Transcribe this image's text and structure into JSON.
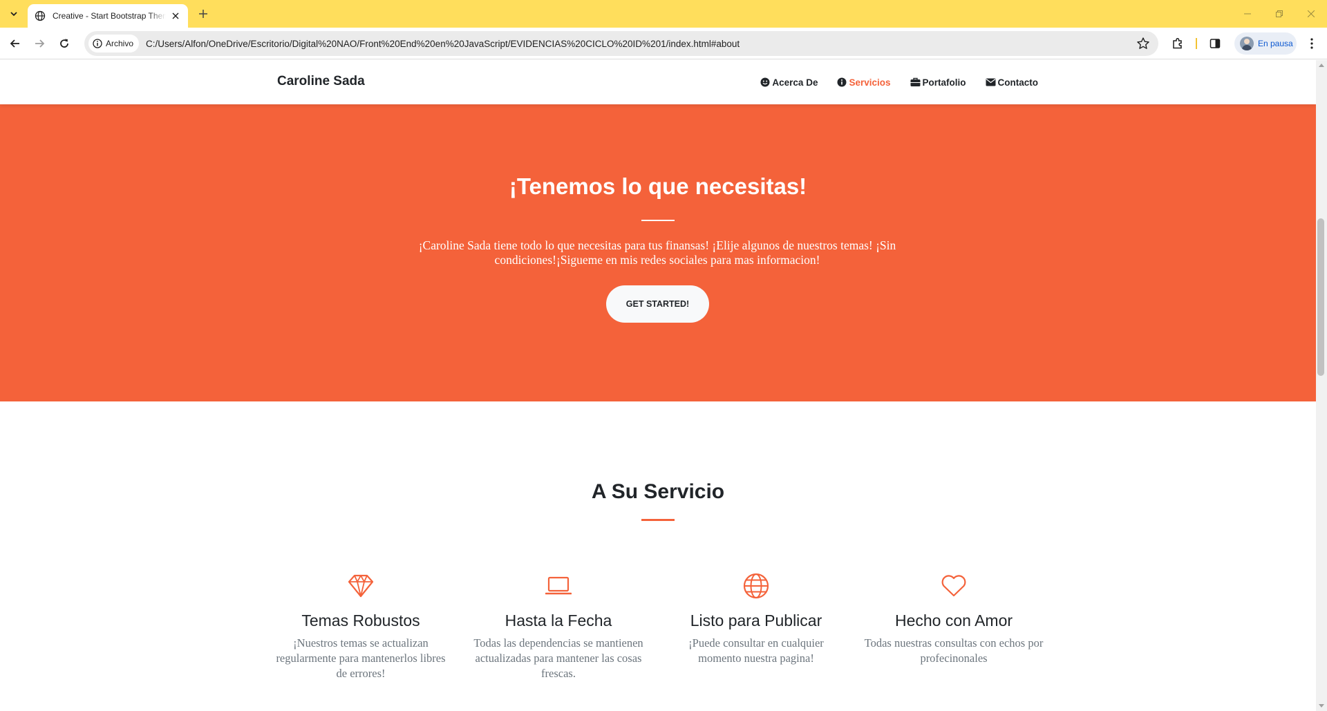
{
  "browser": {
    "tab_title": "Creative - Start Bootstrap Theme",
    "site_chip": "Archivo",
    "url": "C:/Users/Alfon/OneDrive/Escritorio/Digital%20NAO/Front%20End%20en%20JavaScript/EVIDENCIAS%20CICLO%20ID%201/index.html#about",
    "profile_label": "En pausa",
    "colors": {
      "tabbar": "#ffde5c"
    }
  },
  "navbar": {
    "brand": "Caroline Sada",
    "links": [
      {
        "label": "Acerca De",
        "icon": "smile-icon",
        "active": false
      },
      {
        "label": "Servicios",
        "icon": "info-circle-icon",
        "active": true
      },
      {
        "label": "Portafolio",
        "icon": "briefcase-icon",
        "active": false
      },
      {
        "label": "Contacto",
        "icon": "envelope-icon",
        "active": false
      }
    ]
  },
  "hero": {
    "title": "¡Tenemos lo que necesitas!",
    "text": "¡Caroline Sada tiene todo lo que necesitas para tus finansas! ¡Elije algunos de nuestros temas! ¡Sin condiciones!¡Sigueme en mis redes sociales para mas informacion!",
    "button": "GET STARTED!"
  },
  "services": {
    "title": "A Su Servicio",
    "items": [
      {
        "icon": "gem-icon",
        "title": "Temas Robustos",
        "text": "¡Nuestros temas se actualizan regularmente para mantenerlos libres de errores!"
      },
      {
        "icon": "laptop-icon",
        "title": "Hasta la Fecha",
        "text": "Todas las dependencias se mantienen actualizadas para mantener las cosas frescas."
      },
      {
        "icon": "globe-icon",
        "title": "Listo para Publicar",
        "text": "¡Puede consultar en cualquier momento nuestra pagina!"
      },
      {
        "icon": "heart-icon",
        "title": "Hecho con Amor",
        "text": "Todas nuestras consultas con echos por profecinonales"
      }
    ]
  },
  "colors": {
    "primary": "#f4623a",
    "text": "#212529",
    "muted": "#6c757d"
  }
}
